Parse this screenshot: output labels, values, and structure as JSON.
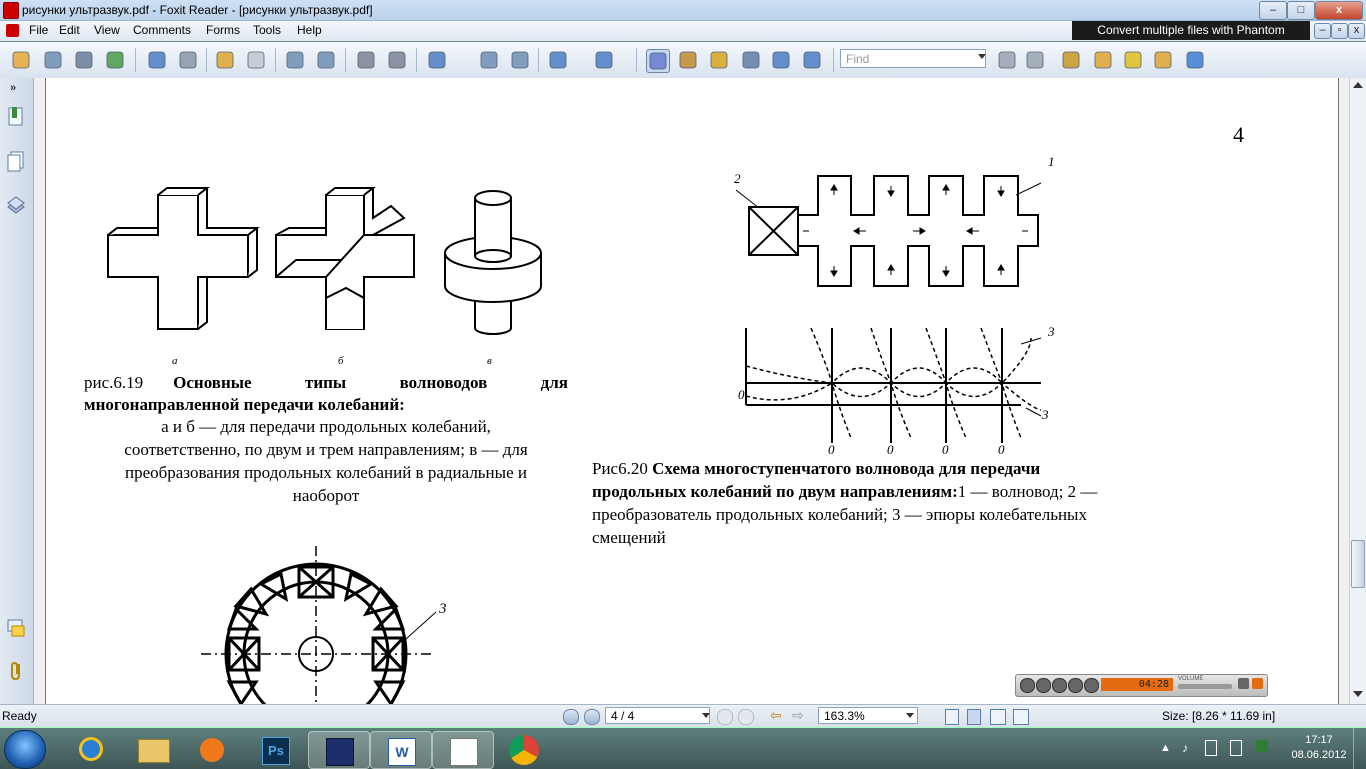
{
  "window": {
    "title": "рисунки ультразвук.pdf - Foxit Reader - [рисунки ультразвук.pdf]",
    "minimize": "–",
    "maximize": "□",
    "close": "x"
  },
  "menu": {
    "items": [
      "File",
      "Edit",
      "View",
      "Comments",
      "Forms",
      "Tools",
      "Help"
    ],
    "banner": "Convert multiple files with Phantom"
  },
  "toolbar": {
    "find_placeholder": "Find",
    "icons": [
      "open-icon",
      "save-icon",
      "print-icon",
      "email-icon",
      "prev-page-icon",
      "next-page-icon",
      "back-icon",
      "forward-icon",
      "extract-icon",
      "insert-icon",
      "undo-icon",
      "redo-icon",
      "zoom-icon",
      "fit-page-icon",
      "fit-width-icon",
      "zoom-out-icon",
      "zoom-in-icon",
      "hand-icon",
      "select-text-icon",
      "pointer-icon",
      "find-icon",
      "typewriter-icon",
      "snapshot-icon",
      "prev-result-icon",
      "next-result-icon",
      "pencil-icon",
      "note-icon",
      "textbox-icon",
      "comment-icon",
      "arrow-icon"
    ]
  },
  "document": {
    "page_number": "4",
    "fig619": {
      "sub_a": "а",
      "sub_b": "б",
      "sub_c": "в",
      "caption_prefix": "рис.6.19",
      "caption_title_line1": "Основные типы волноводов для",
      "caption_title_line2": "многонаправленной передачи колебаний:",
      "caption_body": [
        "а и б — для передачи продольных колебаний,",
        "соответственно, по двум и трем направлениям; в — для",
        "преобразования продольных колебаний в радиальные и",
        "наоборот"
      ]
    },
    "fig620": {
      "label_1": "1",
      "label_2": "2",
      "label_3a": "3",
      "label_3b": "3",
      "zero_left": "0",
      "zeros": [
        "0",
        "0",
        "0",
        "0"
      ],
      "caption_prefix": "Рис6.20",
      "caption_title_line1": "Схема многоступенчатого волновода для передачи",
      "caption_title_line2": "продольных колебаний по двум направлениям:",
      "caption_rest_line2": "1 — волновод; 2 —",
      "caption_line3": "преобразователь продольных колебаний; 3 — эпюры колебательных",
      "caption_line4": "смещений"
    },
    "fig_bottom": {
      "label_3": "3"
    }
  },
  "player": {
    "time": "04:28",
    "volume_label": "VOLUME"
  },
  "statusbar": {
    "ready": "Ready",
    "page_display": "4 / 4",
    "zoom": "163.3%",
    "size": "Size: [8.26 * 11.69 in]"
  },
  "taskbar": {
    "apps": [
      "file-explorer-icon",
      "internet-explorer-icon",
      "media-player-icon",
      "photoshop-icon",
      "save-floppy-icon",
      "word-icon",
      "foxit-icon",
      "chrome-icon"
    ],
    "time": "17:17",
    "date": "08.06.2012"
  }
}
